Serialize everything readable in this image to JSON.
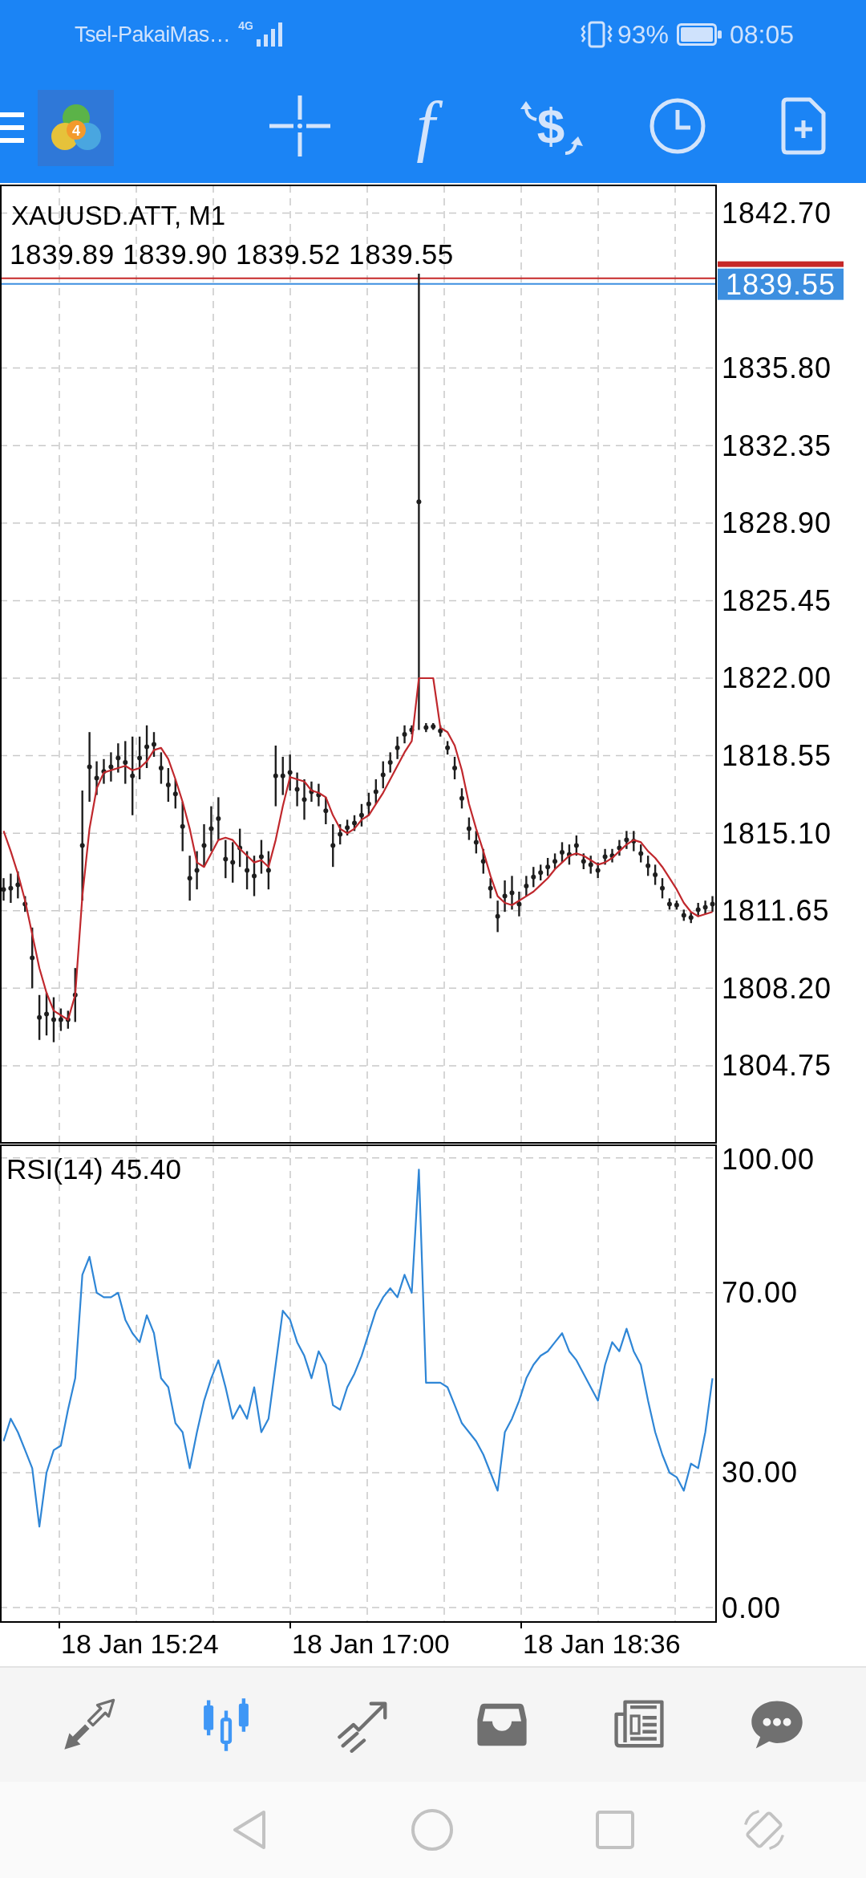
{
  "status_bar": {
    "carrier": "Tsel-PakaiMas…",
    "network": "4G",
    "battery": "93%",
    "time": "08:05"
  },
  "toolbar": {
    "logo_badge": "4",
    "buttons": [
      {
        "kind": "crosshair"
      },
      {
        "kind": "function",
        "glyph": "f"
      },
      {
        "kind": "dollar",
        "glyph": "$"
      },
      {
        "kind": "clock"
      },
      {
        "kind": "new-document"
      }
    ]
  },
  "price_chart": {
    "ohlc": "1839.89 1839.90 1839.52 1839.55",
    "chart_data": {
      "type": "line",
      "title": "XAUUSD.ATT, M1",
      "grid": true,
      "ylim": [
        1801.32,
        1843.93
      ],
      "yticks": [
        {
          "value": 1842.7,
          "label": "1842.70"
        },
        {
          "value": 1835.8,
          "label": "1835.80"
        },
        {
          "value": 1832.35,
          "label": "1832.35"
        },
        {
          "value": 1828.9,
          "label": "1828.90"
        },
        {
          "value": 1825.45,
          "label": "1825.45"
        },
        {
          "value": 1822,
          "label": "1822.00"
        },
        {
          "value": 1818.55,
          "label": "1818.55"
        },
        {
          "value": 1815.1,
          "label": "1815.10"
        },
        {
          "value": 1811.65,
          "label": "1811.65"
        },
        {
          "value": 1808.2,
          "label": "1808.20"
        },
        {
          "value": 1804.75,
          "label": "1804.75"
        }
      ],
      "series": [
        {
          "type": "scatter",
          "color": "#1e1e1e",
          "values": [
            1812.6,
            1812.65,
            1812.8,
            1811.95,
            1809.55,
            1806.9,
            1807.05,
            1806.8,
            1806.8,
            1806.8,
            1807.9,
            1814.55,
            1818.05,
            1817.55,
            1817.85,
            1818.05,
            1818.45,
            1818.25,
            1817.65,
            1818.45,
            1818.95,
            1819.05,
            1818.0,
            1817.25,
            1816.85,
            1815.4,
            1813.1,
            1813.45,
            1814.55,
            1815.3,
            1815.75,
            1813.95,
            1813.8,
            1814.45,
            1813.45,
            1813.2,
            1814.05,
            1813.45,
            1817.65,
            1817.65,
            1817.8,
            1817.05,
            1816.6,
            1816.95,
            1816.8,
            1816.1,
            1814.55,
            1815.05,
            1815.35,
            1815.55,
            1815.9,
            1816.4,
            1816.95,
            1817.7,
            1818.25,
            1818.9,
            1819.5,
            1819.7,
            1829.85,
            1819.8,
            1819.85,
            1819.65,
            1818.9,
            1818.0,
            1816.65,
            1815.3,
            1814.7,
            1813.85,
            1812.65,
            1811.4,
            1812.3,
            1812.45,
            1811.95,
            1812.75,
            1813.15,
            1813.35,
            1813.6,
            1813.85,
            1814.25,
            1814.15,
            1814.55,
            1813.85,
            1813.7,
            1813.45,
            1814.05,
            1814.1,
            1814.45,
            1814.8,
            1814.75,
            1814.2,
            1813.65,
            1813.25,
            1812.65,
            1811.95,
            1811.9,
            1811.45,
            1811.35,
            1811.7,
            1811.8,
            1811.95
          ],
          "errors": [
            0.5,
            0.65,
            0.6,
            0.35,
            1.35,
            1.0,
            0.95,
            1.0,
            0.5,
            0.4,
            1.2,
            2.45,
            1.55,
            0.75,
            0.55,
            0.65,
            0.65,
            0.95,
            1.75,
            0.95,
            0.95,
            0.55,
            0.7,
            0.75,
            0.65,
            1.1,
            1.0,
            0.85,
            0.95,
            1.0,
            0.95,
            0.85,
            0.9,
            0.85,
            0.85,
            0.9,
            0.75,
            0.85,
            1.35,
            0.85,
            0.8,
            0.75,
            0.9,
            0.45,
            0.5,
            0.6,
            0.95,
            0.45,
            0.35,
            0.35,
            0.5,
            0.5,
            0.55,
            0.6,
            0.45,
            0.5,
            0.4,
            0.2,
            10.15,
            0.2,
            0.15,
            0.25,
            0.3,
            0.5,
            0.45,
            0.5,
            0.5,
            0.55,
            0.45,
            0.7,
            0.7,
            0.75,
            0.55,
            0.45,
            0.45,
            0.35,
            0.4,
            0.35,
            0.45,
            0.45,
            0.45,
            0.35,
            0.4,
            0.35,
            0.35,
            0.3,
            0.35,
            0.4,
            0.45,
            0.4,
            0.45,
            0.45,
            0.45,
            0.25,
            0.2,
            0.25,
            0.25,
            0.3,
            0.3,
            0.35
          ]
        },
        {
          "color": "#c0282d",
          "values": [
            1815.2,
            1814.3,
            1813.3,
            1812.1,
            1810.6,
            1809.1,
            1808.0,
            1807.2,
            1807.0,
            1806.8,
            1807.9,
            1812.3,
            1815.3,
            1817.1,
            1817.8,
            1817.9,
            1818.0,
            1818.1,
            1817.9,
            1818.0,
            1818.3,
            1818.8,
            1818.9,
            1818.4,
            1817.5,
            1816.5,
            1815.3,
            1813.8,
            1813.6,
            1814.2,
            1814.8,
            1814.9,
            1814.8,
            1814.4,
            1814.1,
            1813.8,
            1813.9,
            1813.6,
            1814.8,
            1816.3,
            1817.6,
            1817.5,
            1817.4,
            1817.0,
            1816.9,
            1816.7,
            1815.9,
            1815.3,
            1815.1,
            1815.3,
            1815.7,
            1815.9,
            1816.4,
            1816.9,
            1817.5,
            1818.1,
            1818.7,
            1819.2,
            1822.0,
            1822.0,
            1822.0,
            1819.8,
            1819.6,
            1819.0,
            1817.9,
            1816.4,
            1815.3,
            1814.3,
            1813.2,
            1812.3,
            1812.0,
            1811.9,
            1812.1,
            1812.3,
            1812.5,
            1812.8,
            1813.1,
            1813.5,
            1813.8,
            1814.1,
            1814.2,
            1814.1,
            1813.9,
            1813.7,
            1813.8,
            1814.0,
            1814.3,
            1814.6,
            1814.8,
            1814.7,
            1814.3,
            1814.0,
            1813.6,
            1813.1,
            1812.6,
            1812.0,
            1811.6,
            1811.4,
            1811.5,
            1811.6
          ]
        }
      ],
      "ref_lines": [
        {
          "axis": "y",
          "value": 1839.8,
          "color": "#c62828"
        },
        {
          "axis": "y",
          "value": 1839.55,
          "color": "#3d8fe0",
          "label": "1839.55"
        }
      ]
    }
  },
  "rsi_chart": {
    "time_axis": [
      "18 Jan 15:24",
      "18 Jan 17:00",
      "18 Jan 18:36"
    ],
    "chart_data": {
      "type": "line",
      "title": "RSI(14) 45.40",
      "grid": true,
      "ylim": [
        -3.2,
        102.8
      ],
      "yticks": [
        {
          "value": 0,
          "label": "0.00"
        },
        {
          "value": 30,
          "label": "30.00"
        },
        {
          "value": 70,
          "label": "70.00"
        },
        {
          "value": 100,
          "label": "100.00"
        }
      ],
      "series": [
        {
          "color": "#2f86d6",
          "values": [
            37,
            42,
            39,
            35,
            31,
            18,
            30,
            35,
            36,
            44,
            51,
            74,
            78,
            70,
            69,
            69,
            70,
            64,
            61,
            59,
            65,
            61,
            51,
            49,
            41,
            39,
            31,
            39,
            46,
            51,
            55,
            49,
            42,
            45,
            42,
            49,
            39,
            42,
            54,
            66,
            64,
            59,
            56,
            51,
            57,
            54,
            45,
            44,
            49,
            52,
            56,
            61,
            66,
            69,
            71,
            69,
            74,
            70,
            97.4,
            50,
            50,
            50,
            49,
            45,
            41,
            39,
            37,
            34,
            30,
            26,
            39,
            42,
            46,
            51,
            54,
            56,
            57,
            59,
            61,
            57,
            55,
            52,
            49,
            46,
            54,
            59,
            57,
            62,
            57,
            54,
            46,
            39,
            34,
            30,
            29,
            26,
            32,
            31,
            39,
            51
          ]
        }
      ]
    }
  },
  "bottom_nav": [
    {
      "kind": "arrows",
      "selected": false
    },
    {
      "kind": "candles",
      "selected": true
    },
    {
      "kind": "trend",
      "selected": false
    },
    {
      "kind": "inbox",
      "selected": false
    },
    {
      "kind": "newspaper",
      "selected": false
    },
    {
      "kind": "chat",
      "selected": false
    }
  ]
}
